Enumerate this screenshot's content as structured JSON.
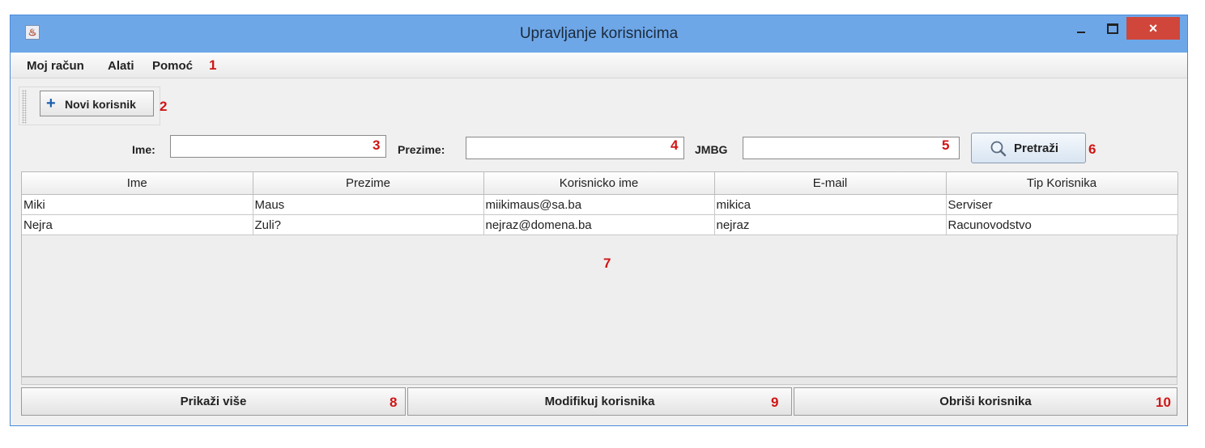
{
  "window": {
    "title": "Upravljanje korisnicima",
    "close_symbol": "×"
  },
  "menu": {
    "items": [
      "Moj račun",
      "Alati",
      "Pomoć"
    ]
  },
  "toolbar": {
    "new_user_label": "Novi korisnik",
    "plus_symbol": "+"
  },
  "search": {
    "ime_label": "Ime:",
    "ime_value": "",
    "prezime_label": "Prezime:",
    "prezime_value": "",
    "jmbg_label": "JMBG",
    "jmbg_value": "",
    "button_label": "Pretraži"
  },
  "table": {
    "columns": [
      "Ime",
      "Prezime",
      "Korisnicko ime",
      "E-mail",
      "Tip Korisnika"
    ],
    "rows": [
      [
        "Miki",
        "Maus",
        "miikimaus@sa.ba",
        "mikica",
        "Serviser"
      ],
      [
        "Nejra",
        "Zuli?",
        "nejraz@domena.ba",
        "nejraz",
        "Racunovodstvo"
      ]
    ]
  },
  "actions": {
    "show_more": "Prikaži više",
    "modify": "Modifikuj korisnika",
    "delete": "Obriši korisnika"
  },
  "annotations": [
    "1",
    "2",
    "3",
    "4",
    "5",
    "6",
    "7",
    "8",
    "9",
    "10"
  ],
  "colors": {
    "titlebar": "#6ea7e8",
    "close_button": "#d0463a",
    "annotation": "#d01515"
  }
}
